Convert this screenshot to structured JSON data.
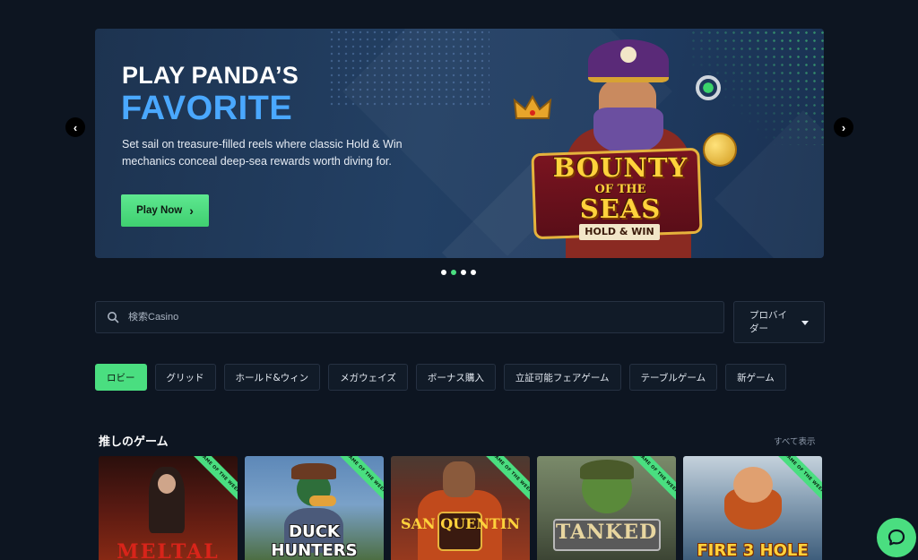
{
  "hero": {
    "title_line1": "PLAY PANDA’S",
    "title_line2": "FAVORITE",
    "description": "Set sail on treasure-filled reels where classic Hold & Win mechanics conceal deep-sea rewards worth diving for.",
    "cta_label": "Play Now",
    "game_logo_line1": "BOUNTY",
    "game_logo_line2": "OF THE",
    "game_logo_line3": "SEAS",
    "game_logo_line4": "HOLD & WIN",
    "slide_count": 4,
    "active_slide": 2
  },
  "search": {
    "placeholder": "検索Casino",
    "value": ""
  },
  "provider_filter": {
    "label": "プロバイダー"
  },
  "categories": [
    {
      "label": "ロビー",
      "active": true
    },
    {
      "label": "グリッド",
      "active": false
    },
    {
      "label": "ホールド&ウィン",
      "active": false
    },
    {
      "label": "メガウェイズ",
      "active": false
    },
    {
      "label": "ボーナス購入",
      "active": false
    },
    {
      "label": "立証可能フェアゲーム",
      "active": false
    },
    {
      "label": "テーブルゲーム",
      "active": false
    },
    {
      "label": "新ゲーム",
      "active": false
    }
  ],
  "section": {
    "title": "推しのゲーム",
    "view_all": "すべて表示"
  },
  "games": [
    {
      "name": "MELTAL",
      "ribbon": "GAME OF THE WEEK"
    },
    {
      "name": "DUCK HUNTERS",
      "ribbon": "GAME OF THE WEEK"
    },
    {
      "name": "SAN QUENTIN",
      "ribbon": "GAME OF THE WEEK"
    },
    {
      "name": "TANKED",
      "ribbon": "GAME OF THE WEEK"
    },
    {
      "name": "FIRE 3 HOLE",
      "ribbon": "GAME OF THE WEEK"
    }
  ],
  "icons": {
    "prev": "chevron-left-icon",
    "next": "chevron-right-icon",
    "search": "search-icon",
    "caret": "caret-down-icon",
    "chat": "chat-icon"
  },
  "colors": {
    "background": "#0d1521",
    "accent": "#4ade80",
    "hero_highlight": "#4aa8ff"
  }
}
